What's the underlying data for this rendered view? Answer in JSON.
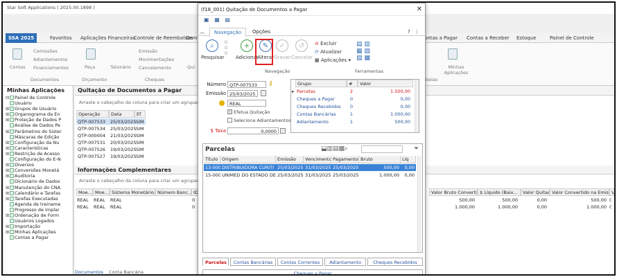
{
  "app": {
    "title": "Star Soft Applications ( 2025.00.1898 )",
    "tabs": [
      {
        "label": "SSA 2025"
      },
      {
        "label": "Favoritos"
      },
      {
        "label": "Aplicações Financeiras"
      },
      {
        "label": "Controle de Reembolsos"
      },
      {
        "label": "Dem"
      },
      {
        "label": "ontas a Pagar"
      },
      {
        "label": "Contas a Receber"
      },
      {
        "label": "Estoque"
      },
      {
        "label": "Painel de Controle"
      }
    ],
    "ribbon": {
      "contas": "Contas",
      "comissoes": "Comissões",
      "adiantamentos": "Adiantamentos",
      "financiamentos": "Financiamentos",
      "documentos": "Documentos",
      "peca": "Peça",
      "orcamento": "Orçamento",
      "tatonario": "Tatonário",
      "emissao": "Emissão",
      "movimentacoes": "Movimentações",
      "cancelamento": "Cancelamento",
      "cheques": "Cheques",
      "qui": "Qui",
      "minhas_aplicacoes": "Minhas Aplicações",
      "belas": "belas"
    }
  },
  "sidebar": {
    "title": "Minhas Aplicações",
    "items": [
      {
        "prefix": "⊟",
        "label": "Painel de Controle"
      },
      {
        "prefix": "",
        "label": "Usuário"
      },
      {
        "prefix": "⊞",
        "label": "Grupos de Usuário"
      },
      {
        "prefix": "⊞",
        "label": "Organograma da En"
      },
      {
        "prefix": "⊞",
        "label": "Proteção de Dados P"
      },
      {
        "prefix": "",
        "label": "Análise de Dados Pe"
      },
      {
        "prefix": "⊞",
        "label": "Parâmetros do Sister"
      },
      {
        "prefix": "",
        "label": "Máscaras de Edição"
      },
      {
        "prefix": "⊞",
        "label": "Configuração da Nu"
      },
      {
        "prefix": "⊞",
        "label": "Características"
      },
      {
        "prefix": "⊞",
        "label": "Restrição de Acesso"
      },
      {
        "prefix": "",
        "label": "Configuração do E-N"
      },
      {
        "prefix": "⊞",
        "label": "Diversos"
      },
      {
        "prefix": "⊞",
        "label": "Conversões Monetá"
      },
      {
        "prefix": "⊞",
        "label": "Auditoria"
      },
      {
        "prefix": "",
        "label": "Dicionário de Dados"
      },
      {
        "prefix": "⊞",
        "label": "Manutenção do CNA"
      },
      {
        "prefix": "⊞",
        "label": "Calendário e Tarefas"
      },
      {
        "prefix": "⊞",
        "label": "Tarefas Executadas"
      },
      {
        "prefix": "",
        "label": "Agenda de treiname"
      },
      {
        "prefix": "",
        "label": "Progresso de implar"
      },
      {
        "prefix": "⊞",
        "label": "Ordenação de Form"
      },
      {
        "prefix": "",
        "label": "Usuários Logados"
      },
      {
        "prefix": "⊞",
        "label": "Importação"
      },
      {
        "prefix": "⊞",
        "label": "Minhas Aplicações"
      },
      {
        "prefix": "",
        "label": "Contas a Pagar"
      }
    ]
  },
  "main": {
    "title": "Quitação de Documentos a Pagar",
    "group_hint": "Arraste o cabeçalho da coluna para criar um agrupame",
    "columns": [
      "Operação",
      "Data",
      "Ef"
    ],
    "rows": [
      [
        "QTP-007533",
        "25/03/2025",
        "SIM"
      ],
      [
        "QTP-007534",
        "25/03/2025",
        "SIM"
      ],
      [
        "QTP-000004",
        "21/03/2025",
        "SIM"
      ],
      [
        "QTP-007531",
        "20/03/2025",
        "SIM"
      ],
      [
        "QTP-007526",
        "19/03/2025",
        "SIM"
      ],
      [
        "QTP-007527",
        "19/03/2025",
        "SIM"
      ]
    ],
    "info_title": "Informações Complementares",
    "info_hint": "Arraste o cabeçalho da coluna para criar um agrupame",
    "info_columns": [
      "Moe...",
      "Moe...",
      "Sistema Monetário...",
      "Número Banc...",
      "ID"
    ],
    "info_rows": [
      [
        "REAL",
        "REAL",
        "REAL",
        "",
        "0"
      ],
      [
        "REAL",
        "REAL",
        "REAL",
        "",
        "0"
      ]
    ],
    "right_columns": [
      "Valor Bruto Convertido",
      "$ Líquido (Baix...",
      "Valor Quitado",
      "Valor Convertido na Emissão",
      "Val"
    ],
    "right_rows": [
      [
        "500,00",
        "500,00",
        "0,00",
        "500,00",
        "0"
      ],
      [
        "1.000,00",
        "1.000,00",
        "0,00",
        "1.000,00",
        "0"
      ]
    ],
    "bottom_tabs": [
      "Documentos",
      "Conta Bancária"
    ]
  },
  "modal": {
    "title": "(f18_001) Quitação de Documentos a Pagar",
    "close": "✕",
    "tabs": [
      "Navegação",
      "Opções"
    ],
    "help": "?",
    "buttons": {
      "pesquisar": "Pesquisar",
      "adicionar": "Adicionar",
      "alterar": "Alterar",
      "gravar": "Gravar",
      "cancelar": "Cancelar",
      "excluir": "Excluir",
      "atualizar": "Atualizar",
      "aplicacoes": "Aplicações"
    },
    "group_navegacao": "Navegação",
    "group_ferramentas": "Ferramentas",
    "form": {
      "numero_label": "Número",
      "numero": "QTP-007533",
      "emissao_label": "Emissão",
      "emissao": "25/03/2025",
      "moeda": "REAL",
      "efetua_quitacao": "Efetua Quitação",
      "seleciona_adiantamentos": "Seleciona Adiantamentos",
      "taxa_label": "$ Taxa",
      "taxa": "0,0000"
    },
    "summary": {
      "columns": [
        "Grupo",
        "#",
        "Valor"
      ],
      "rows": [
        {
          "grupo": "Parcelas",
          "n": "2",
          "valor": "1.500,00",
          "color": "#d01010"
        },
        {
          "grupo": "Cheques a Pagar",
          "n": "0",
          "valor": "0,00",
          "color": "#1f4f9a"
        },
        {
          "grupo": "Cheques Recebidos",
          "n": "0",
          "valor": "0,00",
          "color": "#1f4f9a"
        },
        {
          "grupo": "Contas Bancárias",
          "n": "1",
          "valor": "1.000,00",
          "color": "#1f4f9a"
        },
        {
          "grupo": "Adiantamento",
          "n": "1",
          "valor": "500,00",
          "color": "#1f4f9a"
        }
      ]
    },
    "parcelas": {
      "title": "Parcelas",
      "columns": [
        "Título",
        "Origem",
        "Emissão",
        "Vencimento",
        "Pagamento",
        "Bruto",
        "Líq"
      ],
      "rows": [
        [
          "13-0000",
          "DISTRIBUIDORA CURITI",
          "25/03/2025",
          "31/03/2025",
          "25/03/2025",
          "500,00",
          "0,00"
        ],
        [
          "15-0000",
          "UNIMED DO ESTADO DE",
          "25/03/2025",
          "31/03/2025",
          "25/03/2025",
          "1.000,00",
          "0,00"
        ]
      ]
    },
    "bottom_tabs": [
      "Parcelas",
      "Contas Bancárias",
      "Contas Correntes",
      "Adiantamento",
      "Cheques Recebidos"
    ],
    "cheques_tab": "Cheques a Pagar"
  }
}
